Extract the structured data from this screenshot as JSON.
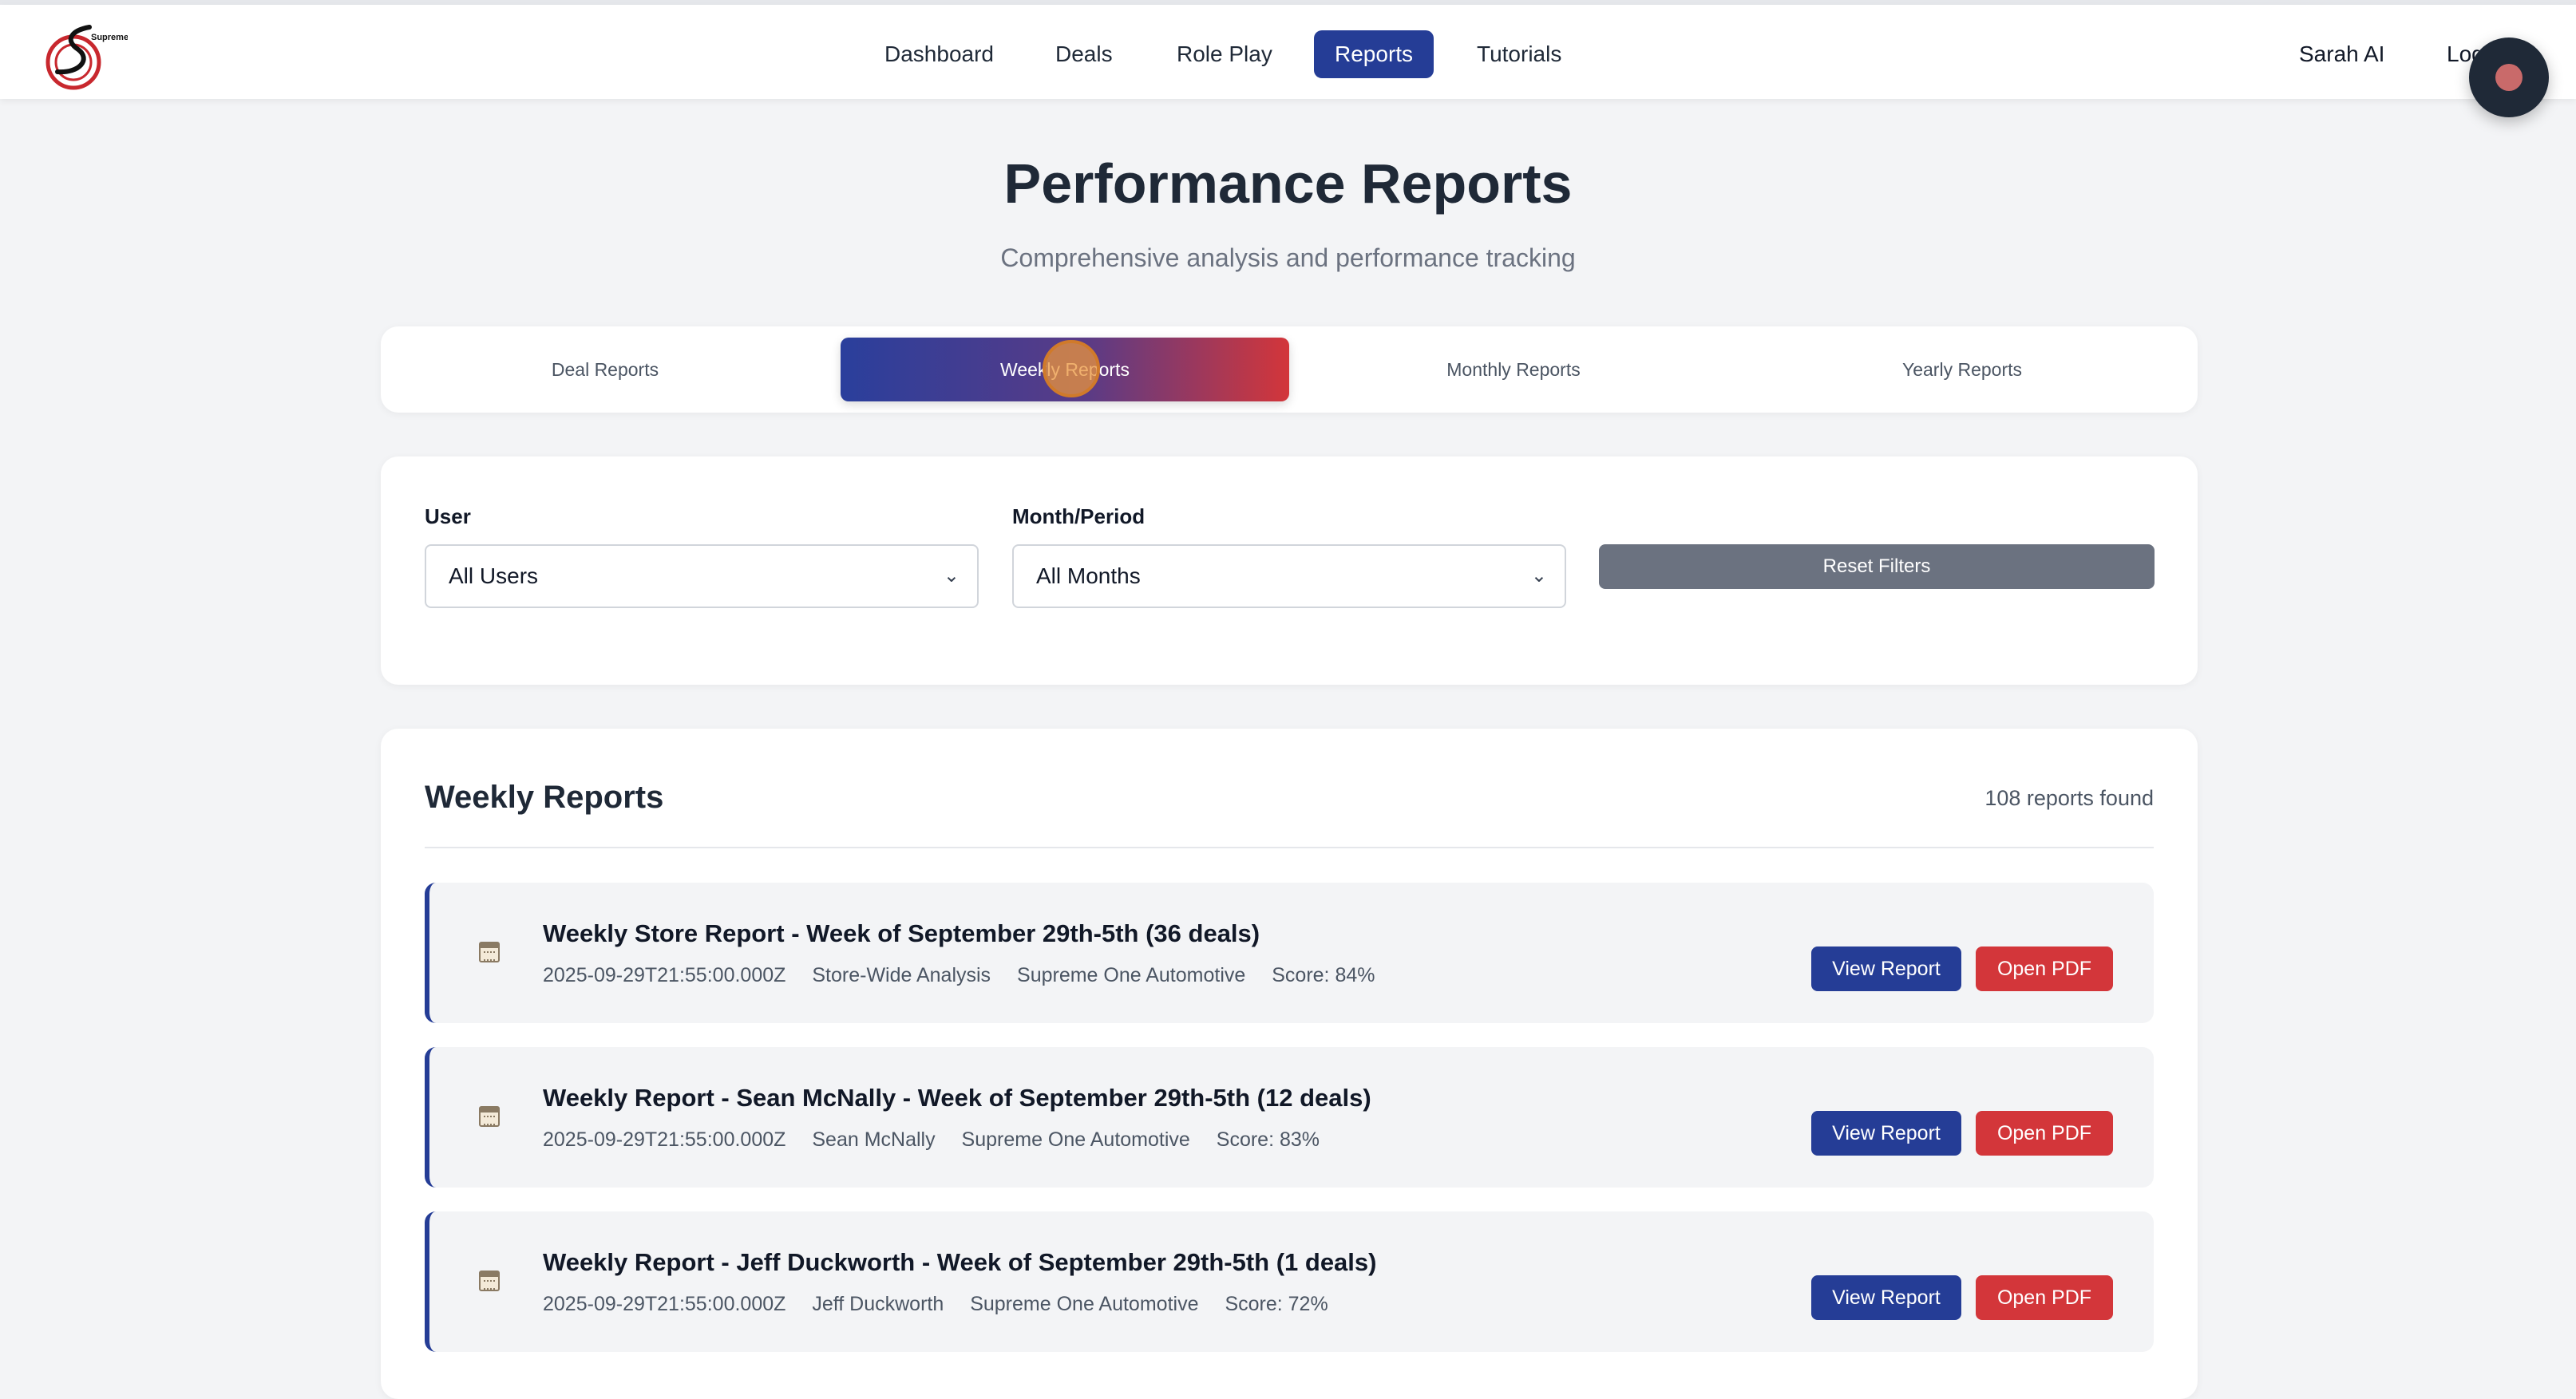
{
  "nav": {
    "brand_text": "Supreme One",
    "links": [
      "Dashboard",
      "Deals",
      "Role Play",
      "Reports",
      "Tutorials"
    ],
    "active_link": "Reports",
    "user_name": "Sarah AI",
    "logout_label": "Logout"
  },
  "header": {
    "title": "Performance Reports",
    "subtitle": "Comprehensive analysis and performance tracking"
  },
  "tabs": {
    "items": [
      "Deal Reports",
      "Weekly Reports",
      "Monthly Reports",
      "Yearly Reports"
    ],
    "active": "Weekly Reports"
  },
  "filters": {
    "user_label": "User",
    "user_value": "All Users",
    "period_label": "Month/Period",
    "period_value": "All Months",
    "reset_label": "Reset Filters"
  },
  "reports": {
    "title": "Weekly Reports",
    "count_text": "108 reports found",
    "view_label": "View Report",
    "pdf_label": "Open PDF",
    "items": [
      {
        "title": "Weekly Store Report - Week of September 29th-5th (36 deals)",
        "date": "2025-09-29T21:55:00.000Z",
        "scope": "Store-Wide Analysis",
        "dealership": "Supreme One Automotive",
        "score": "Score: 84%"
      },
      {
        "title": "Weekly Report - Sean McNally - Week of September 29th-5th (12 deals)",
        "date": "2025-09-29T21:55:00.000Z",
        "scope": "Sean McNally",
        "dealership": "Supreme One Automotive",
        "score": "Score: 83%"
      },
      {
        "title": "Weekly Report - Jeff Duckworth - Week of September 29th-5th (1 deals)",
        "date": "2025-09-29T21:55:00.000Z",
        "scope": "Jeff Duckworth",
        "dealership": "Supreme One Automotive",
        "score": "Score: 72%"
      }
    ]
  },
  "colors": {
    "primary": "#253d96",
    "danger": "#d3363a",
    "neutral_button": "#6b7280",
    "background": "#f3f4f6"
  },
  "icons": {
    "report_item": "calendar-icon",
    "select_chevron": "chevron-down-icon",
    "record": "record-icon"
  }
}
